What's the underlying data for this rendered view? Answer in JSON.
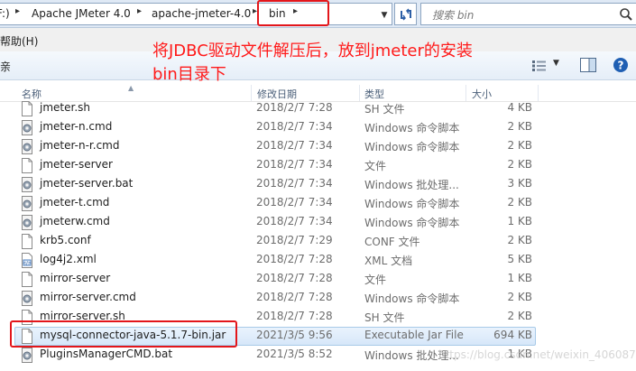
{
  "address_bar": {
    "prefix": "F:)",
    "crumbs": [
      "Apache JMeter 4.0",
      "apache-jmeter-4.0",
      "bin"
    ],
    "search_placeholder": "搜索 bin"
  },
  "menu": {
    "help": "帮助(H)"
  },
  "toolbar": {
    "left_fragment": "亲"
  },
  "annotation": {
    "line1": "将JDBC驱动文件解压后，放到jmeter的安装",
    "line2": "bin目录下"
  },
  "columns": {
    "name": "名称",
    "date": "修改日期",
    "type": "类型",
    "size": "大小"
  },
  "files": [
    {
      "name": "jmeter.sh",
      "date": "2018/2/7 7:28",
      "type": "SH 文件",
      "size": "4 KB",
      "icon": "file-icon"
    },
    {
      "name": "jmeter-n.cmd",
      "date": "2018/2/7 7:34",
      "type": "Windows 命令脚本",
      "size": "2 KB",
      "icon": "cmd-script-icon"
    },
    {
      "name": "jmeter-n-r.cmd",
      "date": "2018/2/7 7:34",
      "type": "Windows 命令脚本",
      "size": "2 KB",
      "icon": "cmd-script-icon"
    },
    {
      "name": "jmeter-server",
      "date": "2018/2/7 7:34",
      "type": "文件",
      "size": "2 KB",
      "icon": "file-icon"
    },
    {
      "name": "jmeter-server.bat",
      "date": "2018/2/7 7:34",
      "type": "Windows 批处理...",
      "size": "3 KB",
      "icon": "batch-file-icon"
    },
    {
      "name": "jmeter-t.cmd",
      "date": "2018/2/7 7:34",
      "type": "Windows 命令脚本",
      "size": "2 KB",
      "icon": "cmd-script-icon"
    },
    {
      "name": "jmeterw.cmd",
      "date": "2018/2/7 7:34",
      "type": "Windows 命令脚本",
      "size": "1 KB",
      "icon": "cmd-script-icon"
    },
    {
      "name": "krb5.conf",
      "date": "2018/2/7 7:29",
      "type": "CONF 文件",
      "size": "2 KB",
      "icon": "file-icon"
    },
    {
      "name": "log4j2.xml",
      "date": "2018/2/7 7:28",
      "type": "XML 文档",
      "size": "5 KB",
      "icon": "xml-file-icon"
    },
    {
      "name": "mirror-server",
      "date": "2018/2/7 7:28",
      "type": "文件",
      "size": "1 KB",
      "icon": "file-icon"
    },
    {
      "name": "mirror-server.cmd",
      "date": "2018/2/7 7:28",
      "type": "Windows 命令脚本",
      "size": "2 KB",
      "icon": "cmd-script-icon"
    },
    {
      "name": "mirror-server.sh",
      "date": "2018/2/7 7:28",
      "type": "SH 文件",
      "size": "2 KB",
      "icon": "file-icon"
    },
    {
      "name": "mysql-connector-java-5.1.7-bin.jar",
      "date": "2021/3/5 9:56",
      "type": "Executable Jar File",
      "size": "694 KB",
      "icon": "jar-file-icon",
      "selected": true
    },
    {
      "name": "PluginsManagerCMD.bat",
      "date": "2021/3/5 8:52",
      "type": "Windows 批处理...",
      "size": "1 KB",
      "icon": "batch-file-icon"
    }
  ],
  "watermark": "https://blog.csdn.net/weixin_40608713"
}
